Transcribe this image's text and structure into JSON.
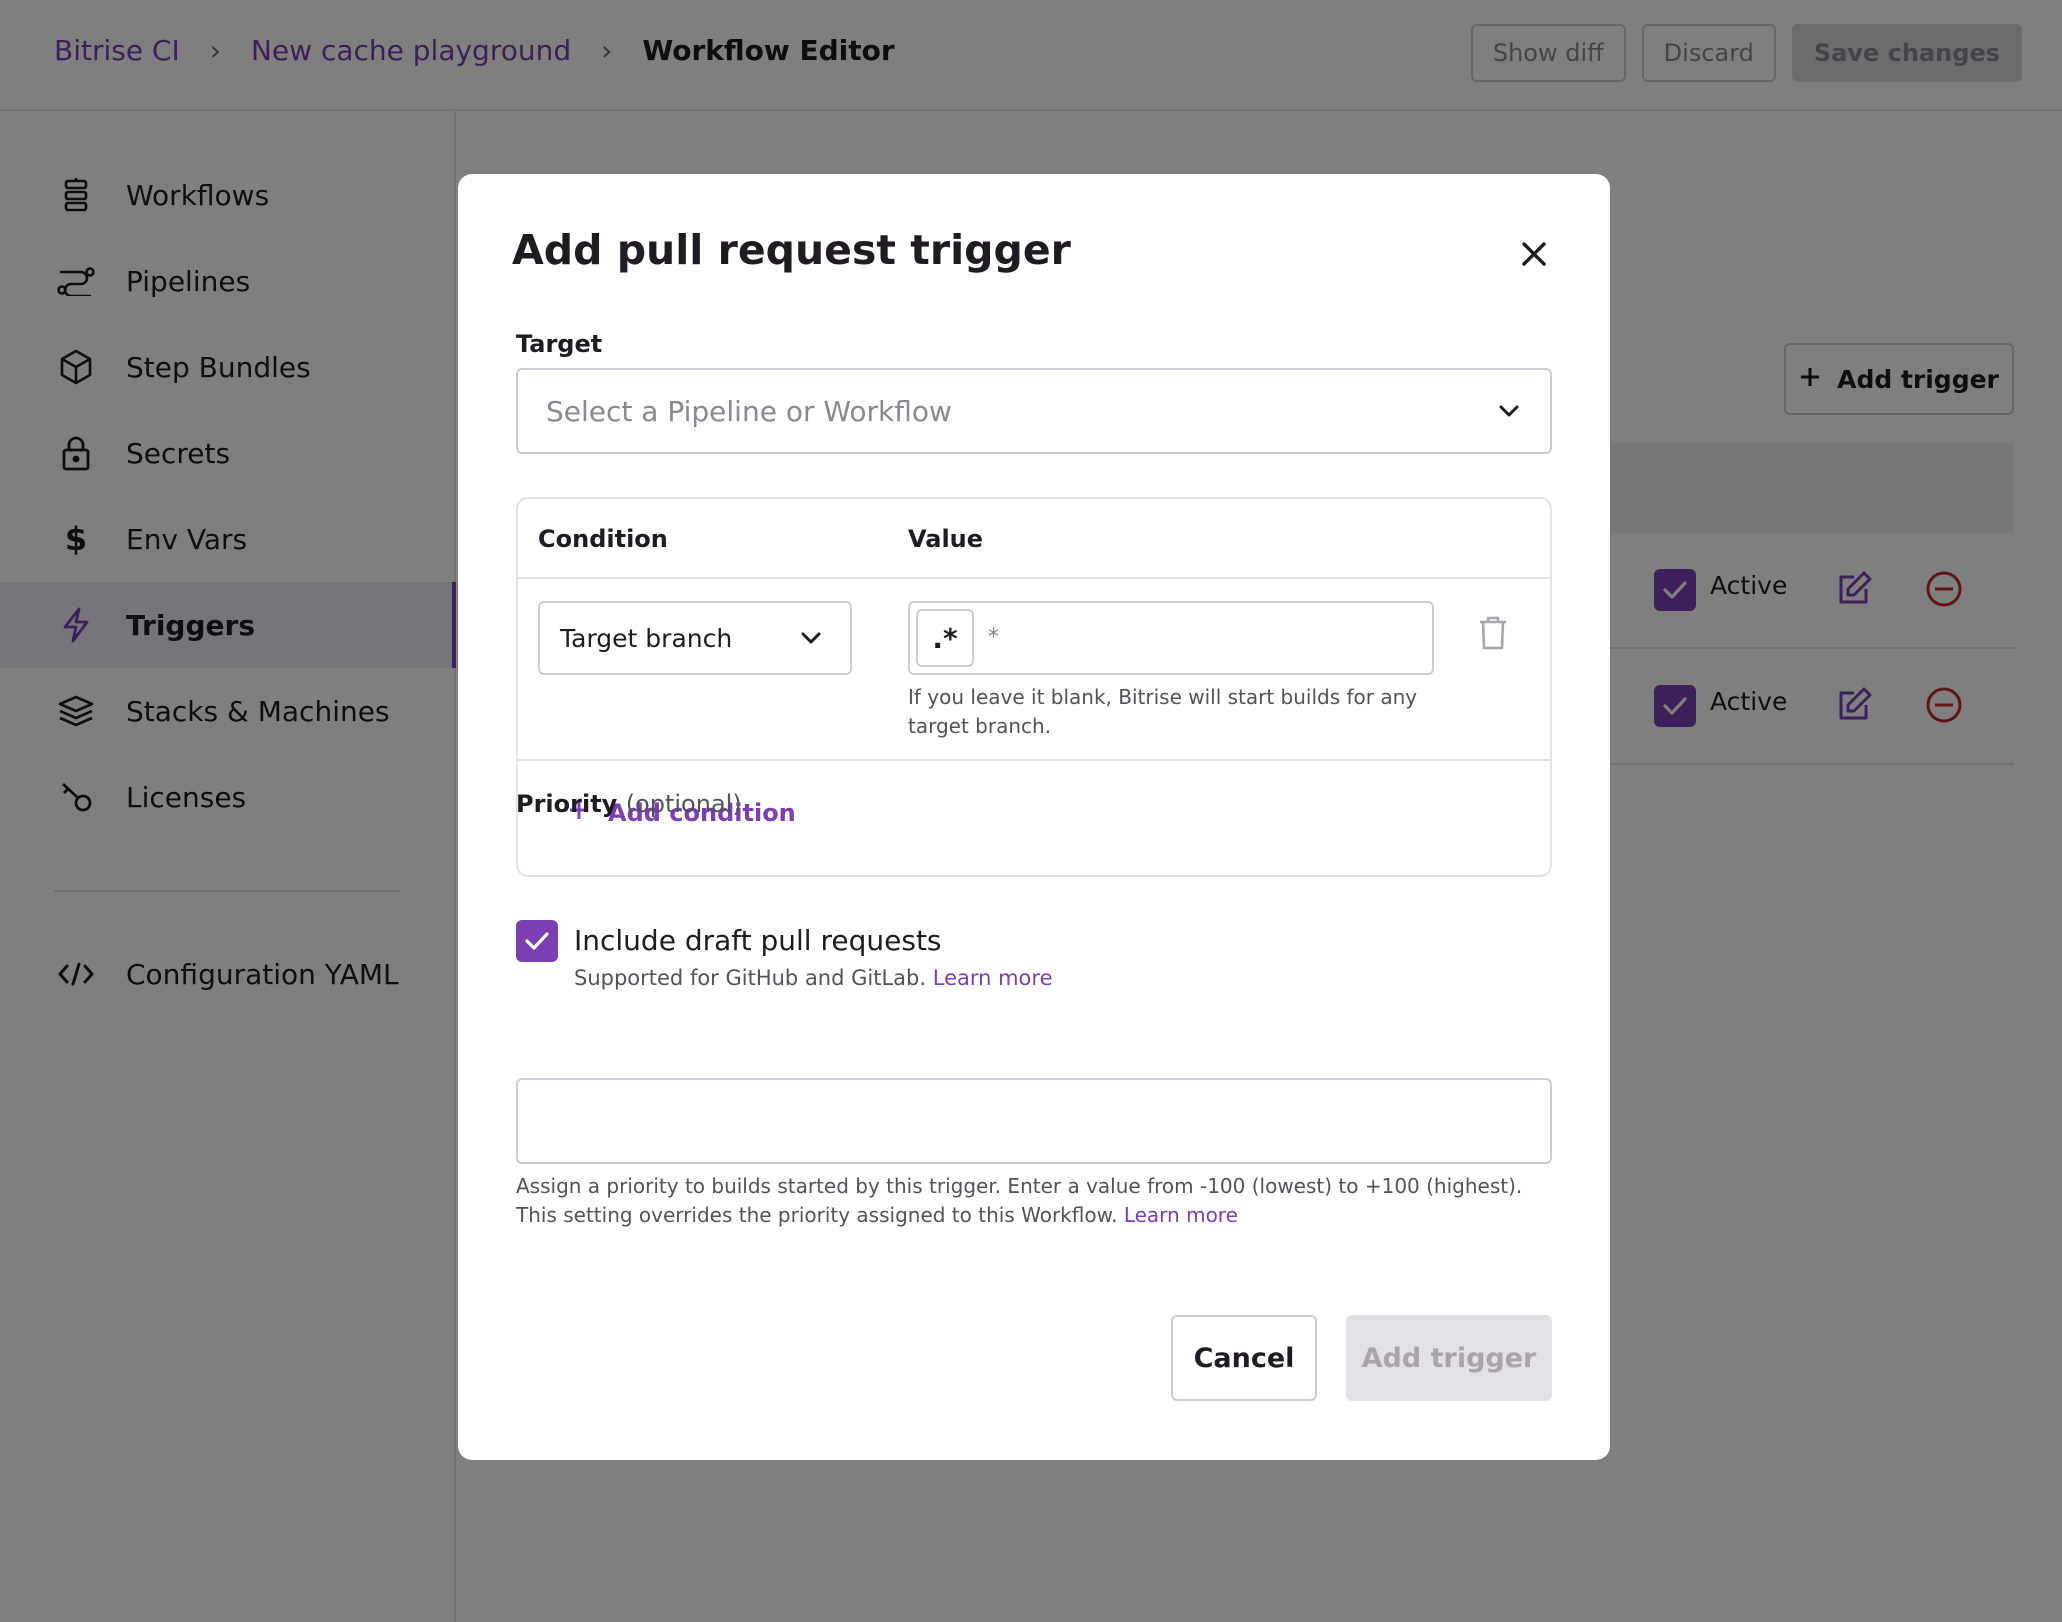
{
  "breadcrumb": {
    "items": [
      "Bitrise CI",
      "New cache playground"
    ],
    "current": "Workflow Editor"
  },
  "topbar": {
    "show_diff": "Show diff",
    "discard": "Discard",
    "save": "Save changes"
  },
  "sidebar": {
    "items": [
      {
        "label": "Workflows",
        "icon": "workflows-icon"
      },
      {
        "label": "Pipelines",
        "icon": "pipelines-icon"
      },
      {
        "label": "Step Bundles",
        "icon": "cube-icon"
      },
      {
        "label": "Secrets",
        "icon": "lock-icon"
      },
      {
        "label": "Env Vars",
        "icon": "dollar-icon"
      },
      {
        "label": "Triggers",
        "icon": "lightning-icon",
        "active": true
      },
      {
        "label": "Stacks & Machines",
        "icon": "layers-icon"
      },
      {
        "label": "Licenses",
        "icon": "key-icon"
      }
    ],
    "config_yaml": "Configuration YAML"
  },
  "background": {
    "add_trigger": "Add trigger",
    "rows": [
      {
        "status": "Active"
      },
      {
        "status": "Active"
      }
    ]
  },
  "modal": {
    "title": "Add pull request trigger",
    "target_label": "Target",
    "target_placeholder": "Select a Pipeline or Workflow",
    "condition_header": "Condition",
    "value_header": "Value",
    "condition_type": "Target branch",
    "regex_label": ".*",
    "value_placeholder": "*",
    "value_help": "If you leave it blank, Bitrise will start builds for any target branch.",
    "add_condition": "Add condition",
    "draft_label": "Include draft pull requests",
    "draft_checked": true,
    "draft_help": "Supported for GitHub and GitLab.",
    "learn_more": "Learn more",
    "priority_label": "Priority",
    "priority_optional": "(optional)",
    "priority_value": "",
    "priority_help": "Assign a priority to builds started by this trigger. Enter a value from -100 (lowest) to +100 (highest). This setting overrides the priority assigned to this Workflow.",
    "cancel": "Cancel",
    "submit": "Add trigger"
  },
  "colors": {
    "accent": "#7b3fb3",
    "danger": "#c2272d",
    "overlay": "rgba(0,0,0,0.5)"
  }
}
